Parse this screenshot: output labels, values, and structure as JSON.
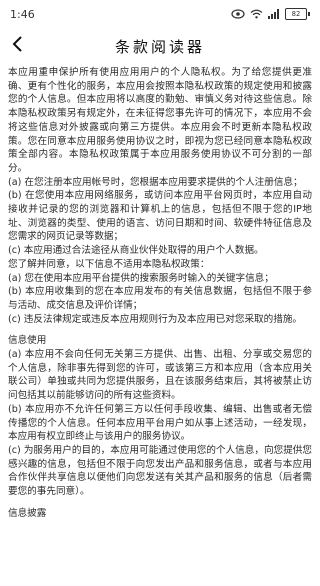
{
  "status_bar": {
    "time": "1:46",
    "battery_level": "82"
  },
  "header": {
    "title": "条款阅读器"
  },
  "body": {
    "intro": "本应用重申保护所有使用应用用户的个人隐私权。为了给您提供更准确、更有个性化的服务，本应用会按照本隐私权政策的规定使用和披露您的个人信息。但本应用将以高度的勤勉、审慎义务对待这些信息。除本隐私权政策另有规定外，在未征得您事先许可的情况下，本应用不会将这些信息对外披露或向第三方提供。本应用会不时更新本隐私权政策。您在同意本应用服务使用协议之时，即视为您已经同意本隐私权政策全部内容。本隐私权政策属于本应用服务使用协议不可分割的一部分。",
    "items": [
      "(a) 在您注册本应用帐号时，您根据本应用要求提供的个人注册信息；",
      "(b) 在您使用本应用网络服务，或访问本应用平台网页时，本应用自动接收并记录的您的浏览器和计算机上的信息，包括但不限于您的IP地址、浏览器的类型、使用的语言、访问日期和时间、软硬件特征信息及您需求的网页记录等数据；",
      "(c) 本应用通过合法途径从商业伙伴处取得的用户个人数据。",
      "您了解并同意，以下信息不适用本隐私权政策：",
      "(a) 您在使用本应用平台提供的搜索服务时输入的关键字信息；",
      "(b) 本应用收集到的您在本应用发布的有关信息数据，包括但不限于参与活动、成交信息及评价详情；",
      "(c) 违反法律规定或违反本应用规则行为及本应用已对您采取的措施。"
    ],
    "section2_title": "信息使用",
    "section2_items": [
      "(a) 本应用不会向任何无关第三方提供、出售、出租、分享或交易您的个人信息，除非事先得到您的许可，或该第三方和本应用（含本应用关联公司）单独或共同为您提供服务，且在该服务结束后，其将被禁止访问包括其以前能够访问的所有这些资料。",
      "(b) 本应用亦不允许任何第三方以任何手段收集、编辑、出售或者无偿传播您的个人信息。任何本应用平台用户如从事上述活动，一经发现，本应用有权立即终止与该用户的服务协议。",
      "(c) 为服务用户的目的，本应用可能通过使用您的个人信息，向您提供您感兴趣的信息，包括但不限于向您发出产品和服务信息，或者与本应用合作伙伴共享信息以便他们向您发送有关其产品和服务的信息（后者需要您的事先同意）。"
    ],
    "section3_title": "信息披露"
  }
}
